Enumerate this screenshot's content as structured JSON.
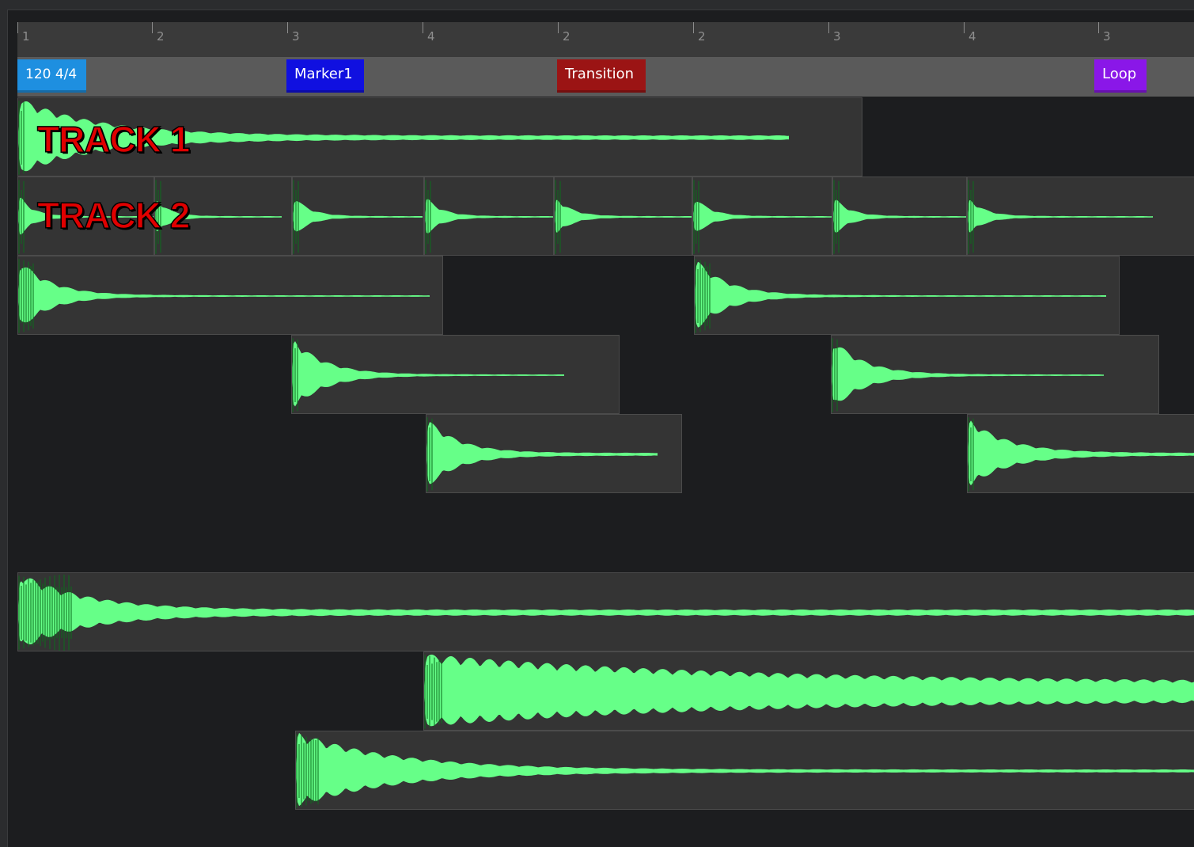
{
  "timeline": {
    "ruler_ticks": [
      "1",
      "2",
      "3",
      "4",
      "2",
      "2",
      "3",
      "4",
      "3"
    ],
    "markers": [
      {
        "id": "tempo",
        "label": "120 4/4",
        "color": "#1e8fe0"
      },
      {
        "id": "marker1",
        "label": "Marker1",
        "color": "#1010e0"
      },
      {
        "id": "transition",
        "label": "Transition",
        "color": "#9b1414"
      },
      {
        "id": "loop",
        "label": "Loop",
        "color": "#8a17e8"
      }
    ],
    "waveform_color": "#66ff88",
    "waveform_dark": "#0b6b1c"
  },
  "tracks": [
    {
      "label": "TRACK 1"
    },
    {
      "label": "TRACK 2"
    }
  ]
}
